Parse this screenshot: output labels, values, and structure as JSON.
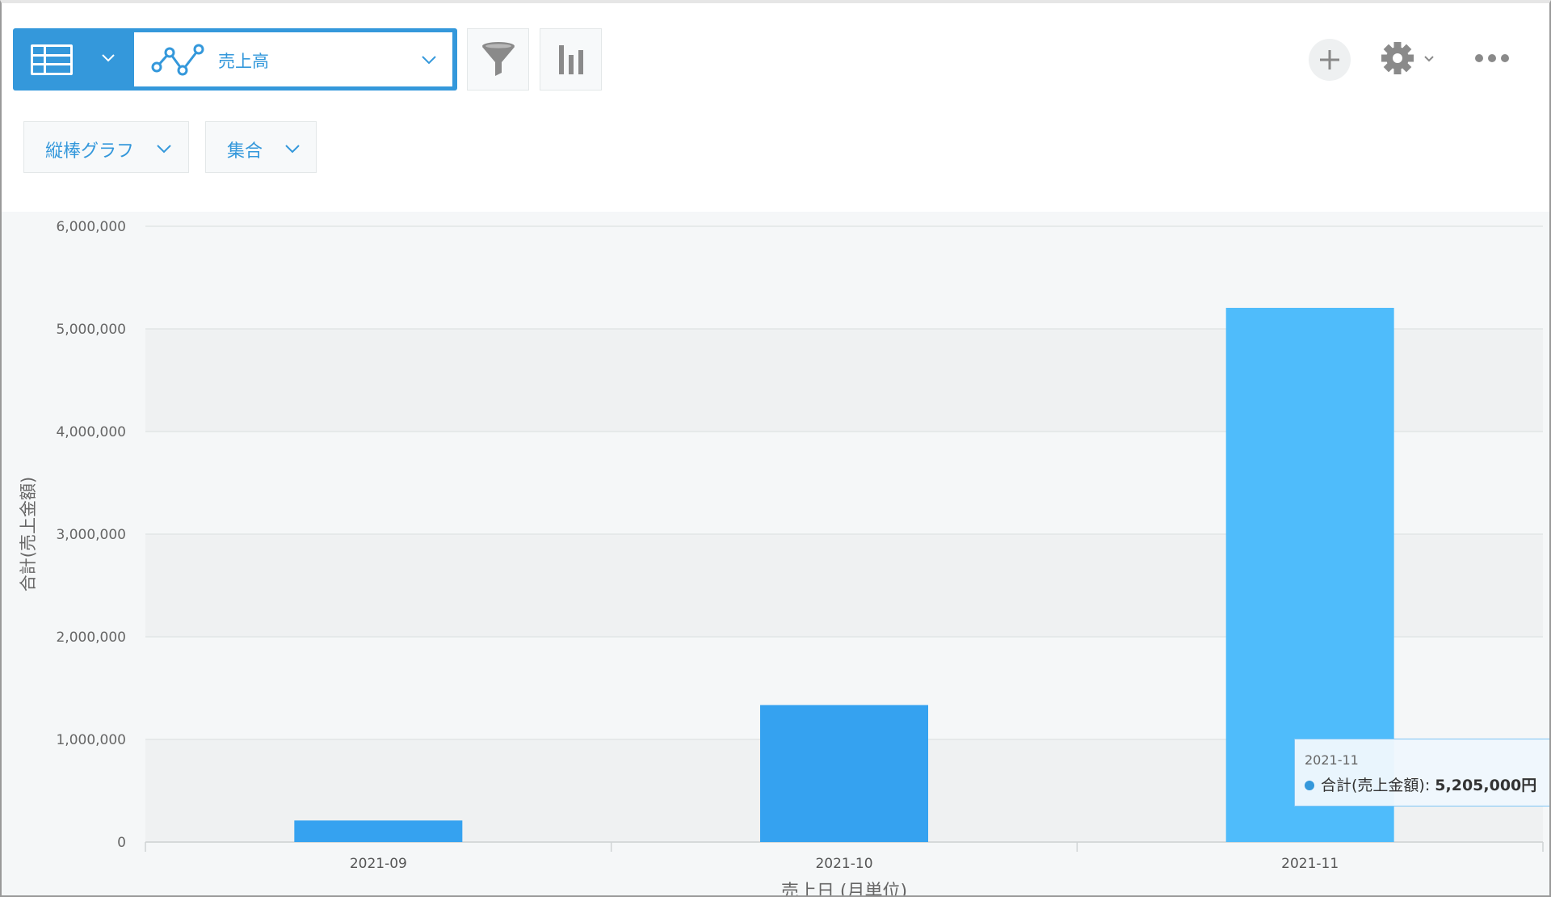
{
  "toolbar": {
    "view_icon": "table-icon",
    "graph_icon": "line-graph-icon",
    "graph_name": "売上高",
    "filter_icon": "filter-icon",
    "chart_icon": "bar-chart-icon",
    "add_icon": "plus-icon",
    "settings_icon": "gear-icon",
    "more_icon": "more-icon"
  },
  "options": {
    "chart_type": "縦棒グラフ",
    "aggregation": "集合"
  },
  "colors": {
    "accent": "#3498db",
    "bar": "#35a2f0",
    "bar_highlight": "#4fbcfb"
  },
  "tooltip": {
    "category": "2021-11",
    "series": "合計(売上金額)",
    "value": "5,205,000円"
  },
  "chart_data": {
    "type": "bar",
    "categories": [
      "2021-09",
      "2021-10",
      "2021-11"
    ],
    "series": [
      {
        "name": "合計(売上金額)",
        "values": [
          210000,
          1335000,
          5205000
        ]
      }
    ],
    "xlabel": "売上日 (月単位)",
    "ylabel": "合計(売上金額)",
    "ylim": [
      0,
      6000000
    ],
    "yticks": [
      0,
      1000000,
      2000000,
      3000000,
      4000000,
      5000000,
      6000000
    ],
    "ytick_labels": [
      "0",
      "1,000,000",
      "2,000,000",
      "3,000,000",
      "4,000,000",
      "5,000,000",
      "6,000,000"
    ],
    "grid": true,
    "highlighted_category": "2021-11"
  }
}
